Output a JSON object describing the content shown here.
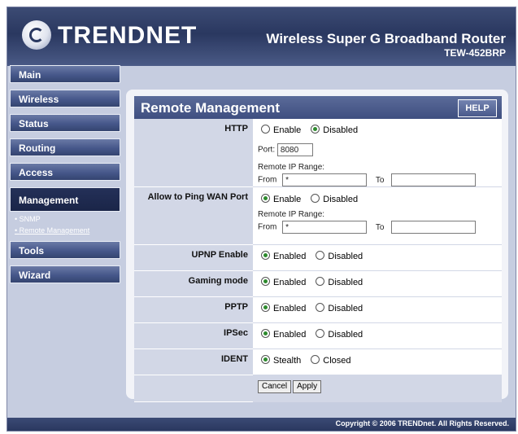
{
  "brand": "TRENDNET",
  "product": "Wireless Super G Broadband Router",
  "model": "TEW-452BRP",
  "nav": {
    "items": [
      "Main",
      "Wireless",
      "Status",
      "Routing",
      "Access"
    ],
    "active": "Management",
    "sub_items": [
      "SNMP",
      "Remote Management"
    ],
    "items_after": [
      "Tools",
      "Wizard"
    ]
  },
  "panel": {
    "title": "Remote Management",
    "help": "HELP"
  },
  "form": {
    "http": {
      "label": "HTTP",
      "enable": "Enable",
      "disabled": "Disabled",
      "selected": "Disabled",
      "port_label": "Port:",
      "port_value": "8080",
      "range_label": "Remote IP Range:",
      "from_label": "From",
      "from_value": "*",
      "to_label": "To",
      "to_value": ""
    },
    "ping": {
      "label": "Allow to Ping WAN Port",
      "enable": "Enable",
      "disabled": "Disabled",
      "selected": "Enable",
      "range_label": "Remote IP Range:",
      "from_label": "From",
      "from_value": "*",
      "to_label": "To",
      "to_value": ""
    },
    "upnp": {
      "label": "UPNP Enable",
      "enabled": "Enabled",
      "disabled": "Disabled",
      "selected": "Enabled"
    },
    "gaming": {
      "label": "Gaming mode",
      "enabled": "Enabled",
      "disabled": "Disabled",
      "selected": "Enabled"
    },
    "pptp": {
      "label": "PPTP",
      "enabled": "Enabled",
      "disabled": "Disabled",
      "selected": "Enabled"
    },
    "ipsec": {
      "label": "IPSec",
      "enabled": "Enabled",
      "disabled": "Disabled",
      "selected": "Enabled"
    },
    "ident": {
      "label": "IDENT",
      "stealth": "Stealth",
      "closed": "Closed",
      "selected": "Stealth"
    },
    "cancel": "Cancel",
    "apply": "Apply"
  },
  "footer": "Copyright © 2006 TRENDnet. All Rights Reserved."
}
